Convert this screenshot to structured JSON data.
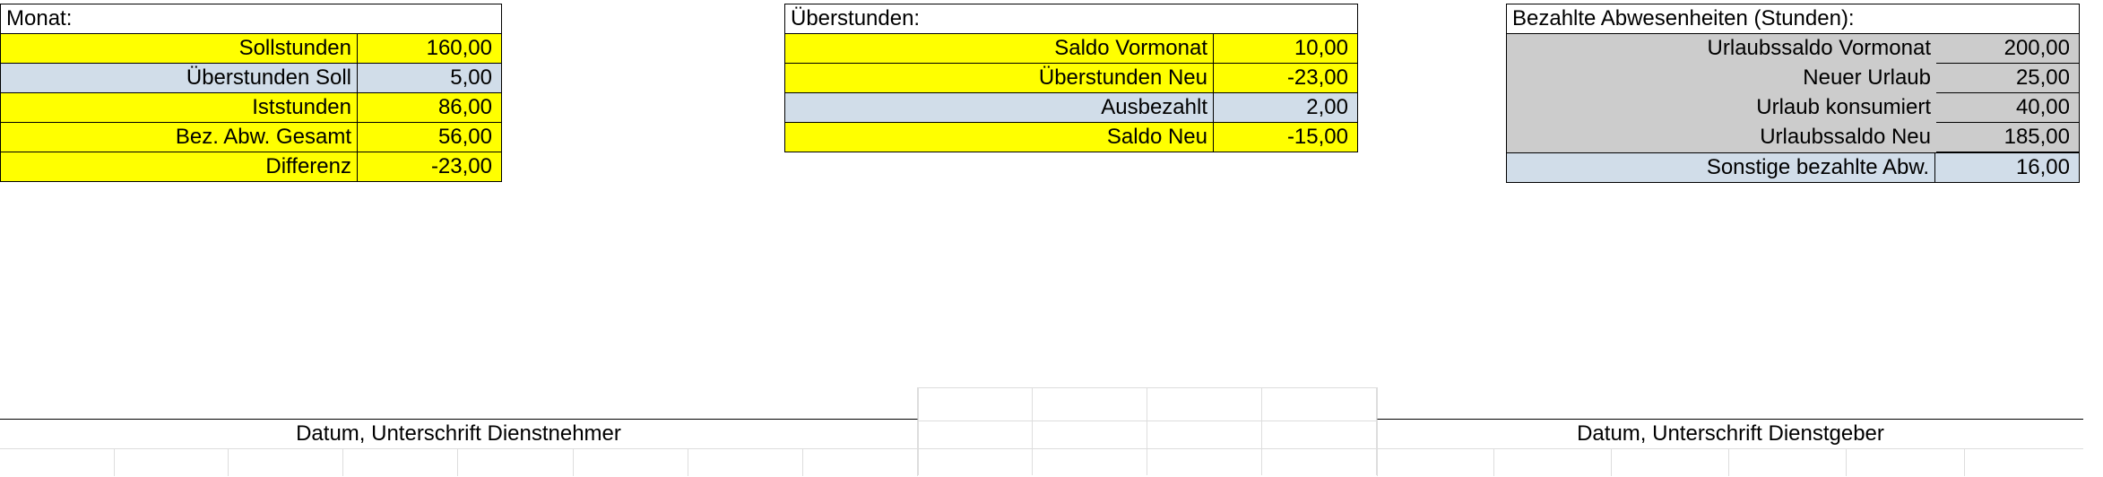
{
  "monat": {
    "header": "Monat:",
    "rows": [
      {
        "label": "Sollstunden",
        "value": "160,00",
        "style": "yellow"
      },
      {
        "label": "Überstunden Soll",
        "value": "5,00",
        "style": "lightblue"
      },
      {
        "label": "Iststunden",
        "value": "86,00",
        "style": "yellow"
      },
      {
        "label": "Bez. Abw. Gesamt",
        "value": "56,00",
        "style": "yellow"
      },
      {
        "label": "Differenz",
        "value": "-23,00",
        "style": "yellow"
      }
    ]
  },
  "ueberstunden": {
    "header": "Überstunden:",
    "rows": [
      {
        "label": "Saldo Vormonat",
        "value": "10,00",
        "style": "yellow"
      },
      {
        "label": "Überstunden Neu",
        "value": "-23,00",
        "style": "yellow"
      },
      {
        "label": "Ausbezahlt",
        "value": "2,00",
        "style": "lightblue"
      },
      {
        "label": "Saldo Neu",
        "value": "-15,00",
        "style": "yellow"
      }
    ]
  },
  "abwesenheiten": {
    "header": "Bezahlte Abwesenheiten (Stunden):",
    "rows": [
      {
        "label": "Urlaubssaldo Vormonat",
        "value": "200,00",
        "style": "grey"
      },
      {
        "label": "Neuer Urlaub",
        "value": "25,00",
        "style": "grey"
      },
      {
        "label": "Urlaub konsumiert",
        "value": "40,00",
        "style": "grey"
      },
      {
        "label": "Urlaubssaldo Neu",
        "value": "185,00",
        "style": "grey"
      },
      {
        "label": "Sonstige bezahlte Abw.",
        "value": "16,00",
        "style": "lightblue"
      }
    ]
  },
  "signatures": {
    "employee": "Datum, Unterschrift Dienstnehmer",
    "employer": "Datum, Unterschrift Dienstgeber"
  }
}
